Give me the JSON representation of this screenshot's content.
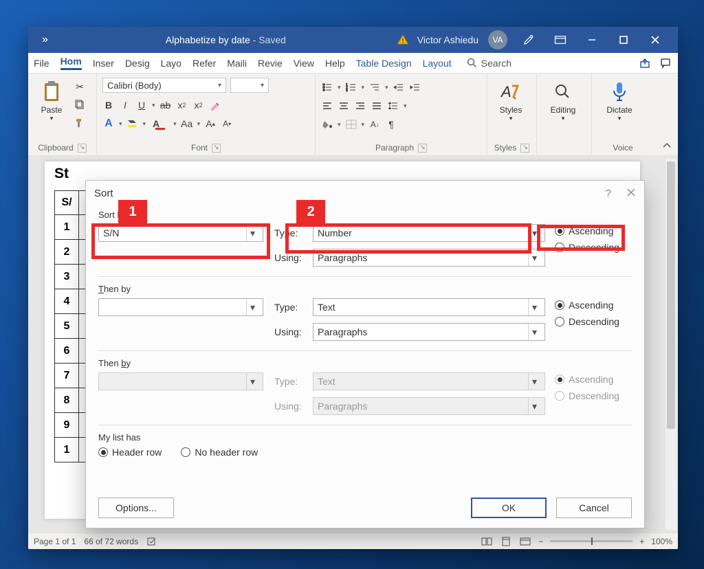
{
  "titlebar": {
    "doc_name": "Alphabetize by date",
    "saved_suffix": " -  Saved",
    "user_name": "Victor Ashiedu",
    "user_initials": "VA"
  },
  "tabs": {
    "items": [
      "File",
      "Home",
      "Insert",
      "Design",
      "Layout",
      "References",
      "Mailings",
      "Review",
      "View",
      "Help",
      "Table Design",
      "Layout"
    ],
    "short": [
      "File",
      "Hom",
      "Inser",
      "Desig",
      "Layo",
      "Refer",
      "Maili",
      "Revie",
      "View",
      "Help",
      "Table Design",
      "Layout"
    ],
    "selected_index": 1,
    "contextual_start_index": 10,
    "search_label": "Search"
  },
  "ribbon": {
    "clipboard": {
      "label": "Clipboard",
      "paste": "Paste"
    },
    "font": {
      "label": "Font",
      "name": "Calibri (Body)"
    },
    "paragraph": {
      "label": "Paragraph"
    },
    "styles": {
      "label": "Styles",
      "btn": "Styles"
    },
    "editing": {
      "label": "Editing",
      "btn": "Editing"
    },
    "voice": {
      "label": "Voice",
      "btn": "Dictate"
    }
  },
  "document": {
    "heading_prefix": "St",
    "row_labels": [
      "S/",
      "1",
      "2",
      "3",
      "4",
      "5",
      "6",
      "7",
      "8",
      "9",
      "1"
    ]
  },
  "status": {
    "page": "Page 1 of 1",
    "words": "66 of 72 words",
    "zoom": "100%"
  },
  "dialog": {
    "title": "Sort",
    "sort_by_label": "Sort by",
    "then_by_label": "Then by",
    "type_label": "Type:",
    "using_label": "Using:",
    "ascending": "Ascending",
    "descending": "Descending",
    "mylist_label": "My list has",
    "header_row": "Header row",
    "no_header_row": "No header row",
    "options": "Options...",
    "ok": "OK",
    "cancel": "Cancel",
    "level1": {
      "field": "S/N",
      "type": "Number",
      "using": "Paragraphs",
      "order": "asc"
    },
    "level2": {
      "field": "",
      "type": "Text",
      "using": "Paragraphs",
      "order": "asc"
    },
    "level3": {
      "field": "",
      "type": "Text",
      "using": "Paragraphs",
      "order": "asc",
      "disabled": true
    },
    "mylist_selected": "header"
  },
  "callouts": {
    "one": "1",
    "two": "2"
  }
}
